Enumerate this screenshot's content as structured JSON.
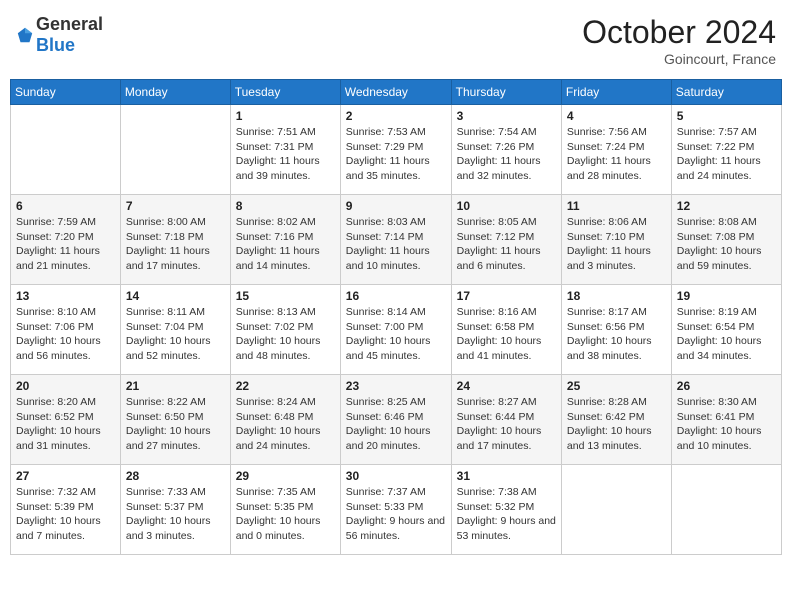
{
  "header": {
    "logo_general": "General",
    "logo_blue": "Blue",
    "month_title": "October 2024",
    "location": "Goincourt, France"
  },
  "weekdays": [
    "Sunday",
    "Monday",
    "Tuesday",
    "Wednesday",
    "Thursday",
    "Friday",
    "Saturday"
  ],
  "weeks": [
    [
      {
        "day": "",
        "info": ""
      },
      {
        "day": "",
        "info": ""
      },
      {
        "day": "1",
        "info": "Sunrise: 7:51 AM\nSunset: 7:31 PM\nDaylight: 11 hours and 39 minutes."
      },
      {
        "day": "2",
        "info": "Sunrise: 7:53 AM\nSunset: 7:29 PM\nDaylight: 11 hours and 35 minutes."
      },
      {
        "day": "3",
        "info": "Sunrise: 7:54 AM\nSunset: 7:26 PM\nDaylight: 11 hours and 32 minutes."
      },
      {
        "day": "4",
        "info": "Sunrise: 7:56 AM\nSunset: 7:24 PM\nDaylight: 11 hours and 28 minutes."
      },
      {
        "day": "5",
        "info": "Sunrise: 7:57 AM\nSunset: 7:22 PM\nDaylight: 11 hours and 24 minutes."
      }
    ],
    [
      {
        "day": "6",
        "info": "Sunrise: 7:59 AM\nSunset: 7:20 PM\nDaylight: 11 hours and 21 minutes."
      },
      {
        "day": "7",
        "info": "Sunrise: 8:00 AM\nSunset: 7:18 PM\nDaylight: 11 hours and 17 minutes."
      },
      {
        "day": "8",
        "info": "Sunrise: 8:02 AM\nSunset: 7:16 PM\nDaylight: 11 hours and 14 minutes."
      },
      {
        "day": "9",
        "info": "Sunrise: 8:03 AM\nSunset: 7:14 PM\nDaylight: 11 hours and 10 minutes."
      },
      {
        "day": "10",
        "info": "Sunrise: 8:05 AM\nSunset: 7:12 PM\nDaylight: 11 hours and 6 minutes."
      },
      {
        "day": "11",
        "info": "Sunrise: 8:06 AM\nSunset: 7:10 PM\nDaylight: 11 hours and 3 minutes."
      },
      {
        "day": "12",
        "info": "Sunrise: 8:08 AM\nSunset: 7:08 PM\nDaylight: 10 hours and 59 minutes."
      }
    ],
    [
      {
        "day": "13",
        "info": "Sunrise: 8:10 AM\nSunset: 7:06 PM\nDaylight: 10 hours and 56 minutes."
      },
      {
        "day": "14",
        "info": "Sunrise: 8:11 AM\nSunset: 7:04 PM\nDaylight: 10 hours and 52 minutes."
      },
      {
        "day": "15",
        "info": "Sunrise: 8:13 AM\nSunset: 7:02 PM\nDaylight: 10 hours and 48 minutes."
      },
      {
        "day": "16",
        "info": "Sunrise: 8:14 AM\nSunset: 7:00 PM\nDaylight: 10 hours and 45 minutes."
      },
      {
        "day": "17",
        "info": "Sunrise: 8:16 AM\nSunset: 6:58 PM\nDaylight: 10 hours and 41 minutes."
      },
      {
        "day": "18",
        "info": "Sunrise: 8:17 AM\nSunset: 6:56 PM\nDaylight: 10 hours and 38 minutes."
      },
      {
        "day": "19",
        "info": "Sunrise: 8:19 AM\nSunset: 6:54 PM\nDaylight: 10 hours and 34 minutes."
      }
    ],
    [
      {
        "day": "20",
        "info": "Sunrise: 8:20 AM\nSunset: 6:52 PM\nDaylight: 10 hours and 31 minutes."
      },
      {
        "day": "21",
        "info": "Sunrise: 8:22 AM\nSunset: 6:50 PM\nDaylight: 10 hours and 27 minutes."
      },
      {
        "day": "22",
        "info": "Sunrise: 8:24 AM\nSunset: 6:48 PM\nDaylight: 10 hours and 24 minutes."
      },
      {
        "day": "23",
        "info": "Sunrise: 8:25 AM\nSunset: 6:46 PM\nDaylight: 10 hours and 20 minutes."
      },
      {
        "day": "24",
        "info": "Sunrise: 8:27 AM\nSunset: 6:44 PM\nDaylight: 10 hours and 17 minutes."
      },
      {
        "day": "25",
        "info": "Sunrise: 8:28 AM\nSunset: 6:42 PM\nDaylight: 10 hours and 13 minutes."
      },
      {
        "day": "26",
        "info": "Sunrise: 8:30 AM\nSunset: 6:41 PM\nDaylight: 10 hours and 10 minutes."
      }
    ],
    [
      {
        "day": "27",
        "info": "Sunrise: 7:32 AM\nSunset: 5:39 PM\nDaylight: 10 hours and 7 minutes."
      },
      {
        "day": "28",
        "info": "Sunrise: 7:33 AM\nSunset: 5:37 PM\nDaylight: 10 hours and 3 minutes."
      },
      {
        "day": "29",
        "info": "Sunrise: 7:35 AM\nSunset: 5:35 PM\nDaylight: 10 hours and 0 minutes."
      },
      {
        "day": "30",
        "info": "Sunrise: 7:37 AM\nSunset: 5:33 PM\nDaylight: 9 hours and 56 minutes."
      },
      {
        "day": "31",
        "info": "Sunrise: 7:38 AM\nSunset: 5:32 PM\nDaylight: 9 hours and 53 minutes."
      },
      {
        "day": "",
        "info": ""
      },
      {
        "day": "",
        "info": ""
      }
    ]
  ]
}
